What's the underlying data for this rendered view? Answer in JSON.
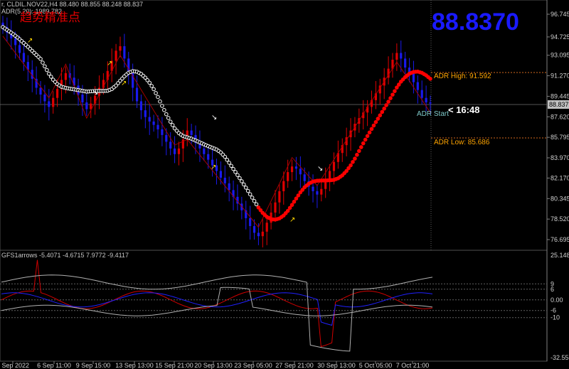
{
  "header": {
    "symbol_line": "r, CLDIL.NOV22,H4  88.480 88.855 88.248 88.837",
    "adr_line": "ADR(5,20): 1989,782",
    "chinese_label": "趋势精准点"
  },
  "big_price": "88.8370",
  "current_price_tag": "88.837",
  "adr": {
    "high_label": "ADR High: 91.592",
    "low_label": "ADR Low: 85.686",
    "start_label": "ADR Start",
    "timer_label": "< 16:48"
  },
  "price_axis": [
    "96.745",
    "94.725",
    "93.095",
    "91.270",
    "89.445",
    "87.620",
    "85.795",
    "83.970",
    "82.170",
    "80.345",
    "78.520",
    "76.695"
  ],
  "indicator": {
    "title": "GFS1arrows -5.4071 -4.6715 7.9772 -9.4117",
    "axis": [
      "25.1483",
      "9",
      "6",
      "0.00",
      "-6",
      "-10",
      "-32.5581"
    ]
  },
  "time_axis": [
    "1 Sep 2022",
    "6 Sep 11:00",
    "9 Sep 15:00",
    "13 Sep 13:00",
    "15 Sep 21:00",
    "20 Sep 13:00",
    "23 Sep 05:00",
    "27 Sep 21:00",
    "30 Sep 13:00",
    "5 Oct 05:00",
    "7 Oct 21:00"
  ],
  "colors": {
    "bull": "#e00000",
    "bear": "#1a1aee",
    "trail_white": "#ffffff",
    "trail_red": "#ff0000",
    "adr_line": "#d2691e",
    "price_big": "#1a1aff"
  },
  "series": {
    "closes": [
      95.6,
      95.1,
      94.6,
      94.0,
      93.3,
      92.5,
      91.8,
      91.0,
      90.2,
      89.6,
      89.0,
      88.5,
      89.3,
      90.1,
      90.9,
      91.5,
      91.1,
      90.4,
      89.6,
      88.9,
      88.3,
      88.8,
      89.5,
      90.2,
      90.9,
      91.7,
      92.6,
      93.5,
      93.9,
      92.8,
      91.5,
      90.2,
      89.0,
      88.2,
      87.6,
      87.2,
      86.9,
      86.5,
      86.0,
      85.4,
      84.8,
      84.3,
      84.8,
      85.6,
      86.4,
      86.0,
      85.3,
      84.8,
      84.3,
      83.8,
      83.3,
      82.8,
      82.2,
      81.7,
      81.1,
      80.5,
      79.9,
      79.3,
      78.6,
      77.9,
      77.3,
      77.0,
      77.4,
      78.2,
      79.1,
      80.0,
      81.0,
      81.9,
      82.7,
      83.2,
      83.0,
      82.5,
      81.9,
      81.4,
      81.0,
      80.7,
      81.2,
      82.0,
      82.8,
      83.6,
      84.4,
      85.1,
      85.8,
      86.4,
      87.0,
      87.5,
      88.0,
      88.5,
      89.1,
      89.7,
      90.4,
      91.1,
      91.9,
      92.7,
      93.3,
      92.8,
      92.0,
      91.5,
      90.7,
      90.0,
      89.3,
      88.9,
      88.8
    ]
  },
  "signal_arrows": [
    {
      "dir": "up",
      "color": "yellow"
    },
    {
      "dir": "down",
      "color": "white"
    },
    {
      "dir": "up",
      "color": "yellow"
    }
  ]
}
